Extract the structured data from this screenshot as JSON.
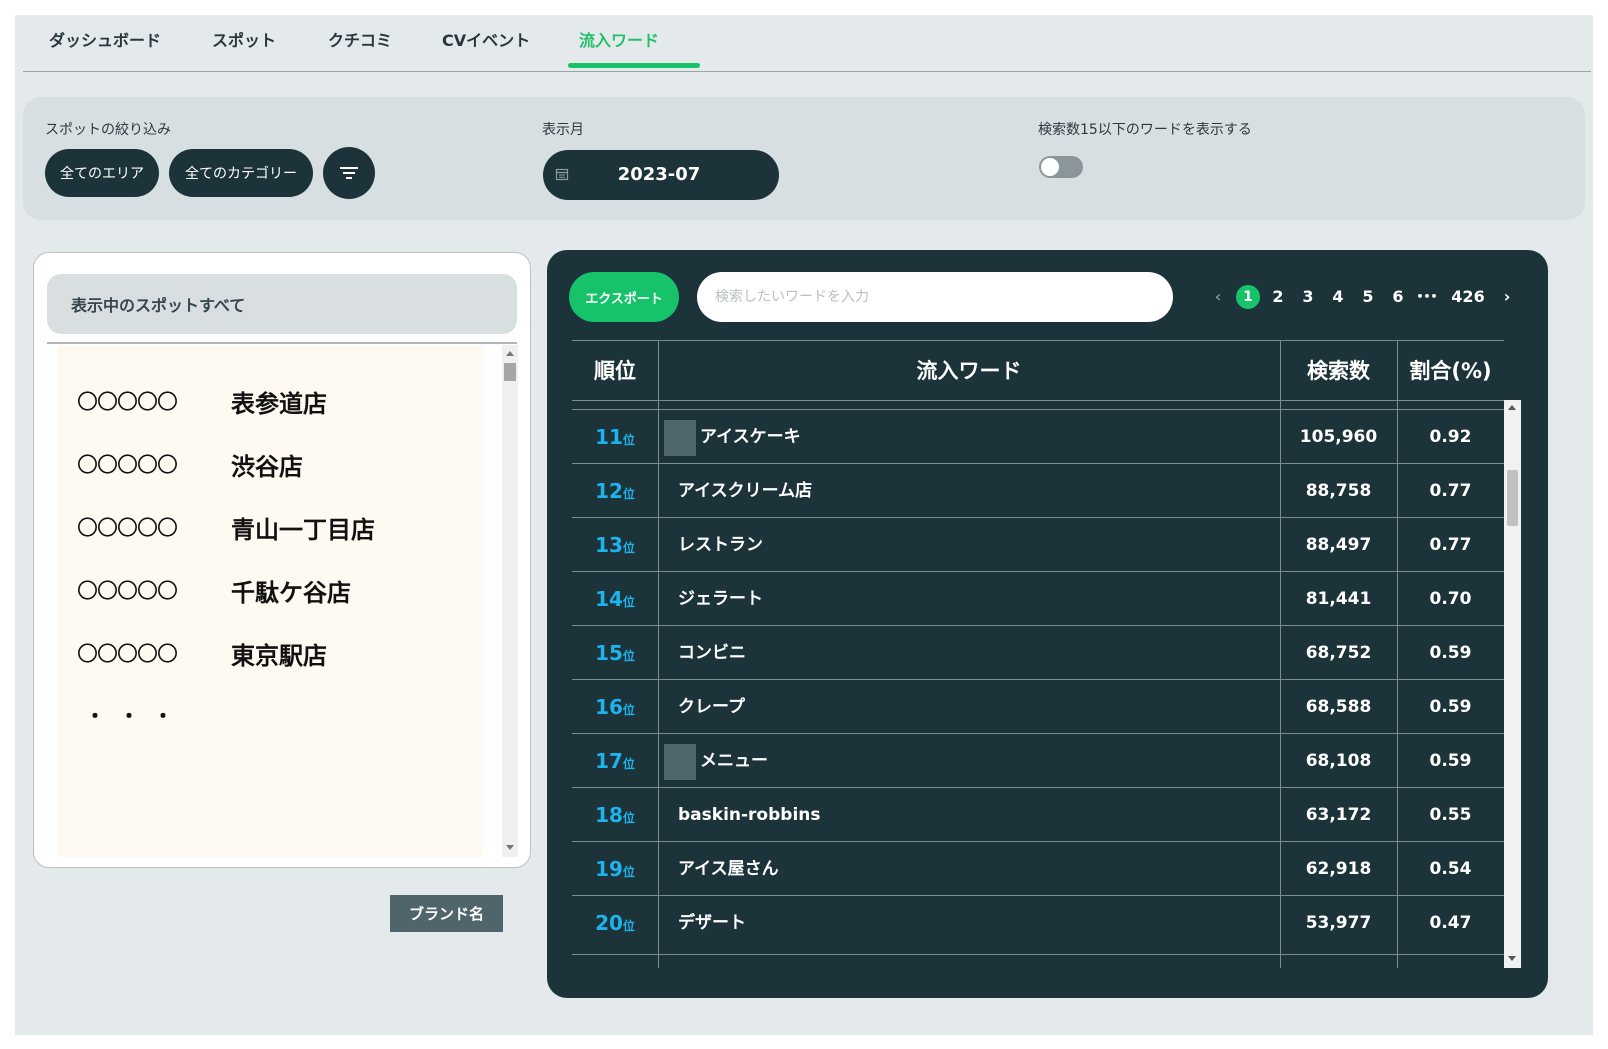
{
  "tabs": [
    {
      "label": "ダッシュボード"
    },
    {
      "label": "スポット"
    },
    {
      "label": "クチコミ"
    },
    {
      "label": "CVイベント"
    },
    {
      "label": "流入ワード"
    }
  ],
  "active_tab": "流入ワード",
  "filters": {
    "spot_label": "スポットの絞り込み",
    "area_button": "全てのエリア",
    "category_button": "全てのカテゴリー",
    "month_label": "表示月",
    "month_value": "2023-07",
    "low_count_label": "検索数15以下のワードを表示する",
    "low_count_enabled": false
  },
  "spots_panel": {
    "header": "表示中のスポットすべて",
    "items": [
      {
        "mask": "〇〇〇〇〇",
        "name": "表参道店"
      },
      {
        "mask": "〇〇〇〇〇",
        "name": "渋谷店"
      },
      {
        "mask": "〇〇〇〇〇",
        "name": "青山一丁目店"
      },
      {
        "mask": "〇〇〇〇〇",
        "name": "千駄ケ谷店"
      },
      {
        "mask": "〇〇〇〇〇",
        "name": "東京駅店"
      }
    ],
    "more": "・・・",
    "brand_button": "ブランド名"
  },
  "toolbar": {
    "export_label": "エクスポート",
    "search_placeholder": "検索したいワードを入力"
  },
  "pagination": {
    "prev": "‹",
    "pages": [
      "1",
      "2",
      "3",
      "4",
      "5",
      "6"
    ],
    "active": "1",
    "ellipsis": "•••",
    "last": "426",
    "next": "›"
  },
  "table": {
    "headers": {
      "rank": "順位",
      "word": "流入ワード",
      "count": "検索数",
      "ratio": "割合(%)"
    },
    "rank_suffix": "位",
    "rows": [
      {
        "rank": "11",
        "word": "アイスケーキ",
        "count": "105,960",
        "ratio": "0.92",
        "thumb": true
      },
      {
        "rank": "12",
        "word": "アイスクリーム店",
        "count": "88,758",
        "ratio": "0.77",
        "thumb": false
      },
      {
        "rank": "13",
        "word": "レストラン",
        "count": "88,497",
        "ratio": "0.77",
        "thumb": false
      },
      {
        "rank": "14",
        "word": "ジェラート",
        "count": "81,441",
        "ratio": "0.70",
        "thumb": false
      },
      {
        "rank": "15",
        "word": "コンビニ",
        "count": "68,752",
        "ratio": "0.59",
        "thumb": false
      },
      {
        "rank": "16",
        "word": "クレープ",
        "count": "68,588",
        "ratio": "0.59",
        "thumb": false
      },
      {
        "rank": "17",
        "word": "メニュー",
        "count": "68,108",
        "ratio": "0.59",
        "thumb": true
      },
      {
        "rank": "18",
        "word": "baskin-robbins",
        "count": "63,172",
        "ratio": "0.55",
        "thumb": false
      },
      {
        "rank": "19",
        "word": "アイス屋さん",
        "count": "62,918",
        "ratio": "0.54",
        "thumb": false
      },
      {
        "rank": "20",
        "word": "デザート",
        "count": "53,977",
        "ratio": "0.47",
        "thumb": false
      }
    ]
  },
  "colors": {
    "accent": "#16c36b",
    "rank": "#1db3ec",
    "panel_dark": "#1c333a",
    "background": "#e4eaec"
  }
}
